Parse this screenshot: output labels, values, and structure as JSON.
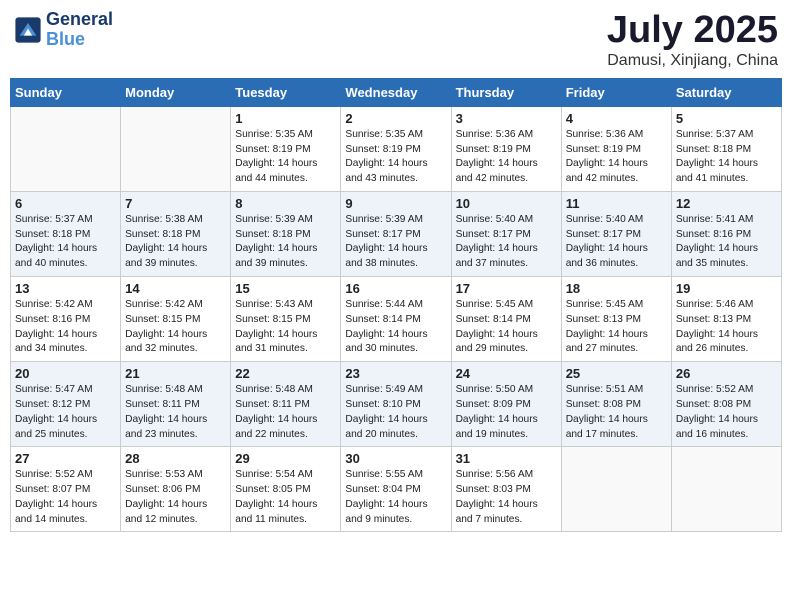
{
  "header": {
    "logo_line1": "General",
    "logo_line2": "Blue",
    "month": "July 2025",
    "location": "Damusi, Xinjiang, China"
  },
  "weekdays": [
    "Sunday",
    "Monday",
    "Tuesday",
    "Wednesday",
    "Thursday",
    "Friday",
    "Saturday"
  ],
  "weeks": [
    [
      {
        "day": "",
        "info": ""
      },
      {
        "day": "",
        "info": ""
      },
      {
        "day": "1",
        "info": "Sunrise: 5:35 AM\nSunset: 8:19 PM\nDaylight: 14 hours and 44 minutes."
      },
      {
        "day": "2",
        "info": "Sunrise: 5:35 AM\nSunset: 8:19 PM\nDaylight: 14 hours and 43 minutes."
      },
      {
        "day": "3",
        "info": "Sunrise: 5:36 AM\nSunset: 8:19 PM\nDaylight: 14 hours and 42 minutes."
      },
      {
        "day": "4",
        "info": "Sunrise: 5:36 AM\nSunset: 8:19 PM\nDaylight: 14 hours and 42 minutes."
      },
      {
        "day": "5",
        "info": "Sunrise: 5:37 AM\nSunset: 8:18 PM\nDaylight: 14 hours and 41 minutes."
      }
    ],
    [
      {
        "day": "6",
        "info": "Sunrise: 5:37 AM\nSunset: 8:18 PM\nDaylight: 14 hours and 40 minutes."
      },
      {
        "day": "7",
        "info": "Sunrise: 5:38 AM\nSunset: 8:18 PM\nDaylight: 14 hours and 39 minutes."
      },
      {
        "day": "8",
        "info": "Sunrise: 5:39 AM\nSunset: 8:18 PM\nDaylight: 14 hours and 39 minutes."
      },
      {
        "day": "9",
        "info": "Sunrise: 5:39 AM\nSunset: 8:17 PM\nDaylight: 14 hours and 38 minutes."
      },
      {
        "day": "10",
        "info": "Sunrise: 5:40 AM\nSunset: 8:17 PM\nDaylight: 14 hours and 37 minutes."
      },
      {
        "day": "11",
        "info": "Sunrise: 5:40 AM\nSunset: 8:17 PM\nDaylight: 14 hours and 36 minutes."
      },
      {
        "day": "12",
        "info": "Sunrise: 5:41 AM\nSunset: 8:16 PM\nDaylight: 14 hours and 35 minutes."
      }
    ],
    [
      {
        "day": "13",
        "info": "Sunrise: 5:42 AM\nSunset: 8:16 PM\nDaylight: 14 hours and 34 minutes."
      },
      {
        "day": "14",
        "info": "Sunrise: 5:42 AM\nSunset: 8:15 PM\nDaylight: 14 hours and 32 minutes."
      },
      {
        "day": "15",
        "info": "Sunrise: 5:43 AM\nSunset: 8:15 PM\nDaylight: 14 hours and 31 minutes."
      },
      {
        "day": "16",
        "info": "Sunrise: 5:44 AM\nSunset: 8:14 PM\nDaylight: 14 hours and 30 minutes."
      },
      {
        "day": "17",
        "info": "Sunrise: 5:45 AM\nSunset: 8:14 PM\nDaylight: 14 hours and 29 minutes."
      },
      {
        "day": "18",
        "info": "Sunrise: 5:45 AM\nSunset: 8:13 PM\nDaylight: 14 hours and 27 minutes."
      },
      {
        "day": "19",
        "info": "Sunrise: 5:46 AM\nSunset: 8:13 PM\nDaylight: 14 hours and 26 minutes."
      }
    ],
    [
      {
        "day": "20",
        "info": "Sunrise: 5:47 AM\nSunset: 8:12 PM\nDaylight: 14 hours and 25 minutes."
      },
      {
        "day": "21",
        "info": "Sunrise: 5:48 AM\nSunset: 8:11 PM\nDaylight: 14 hours and 23 minutes."
      },
      {
        "day": "22",
        "info": "Sunrise: 5:48 AM\nSunset: 8:11 PM\nDaylight: 14 hours and 22 minutes."
      },
      {
        "day": "23",
        "info": "Sunrise: 5:49 AM\nSunset: 8:10 PM\nDaylight: 14 hours and 20 minutes."
      },
      {
        "day": "24",
        "info": "Sunrise: 5:50 AM\nSunset: 8:09 PM\nDaylight: 14 hours and 19 minutes."
      },
      {
        "day": "25",
        "info": "Sunrise: 5:51 AM\nSunset: 8:08 PM\nDaylight: 14 hours and 17 minutes."
      },
      {
        "day": "26",
        "info": "Sunrise: 5:52 AM\nSunset: 8:08 PM\nDaylight: 14 hours and 16 minutes."
      }
    ],
    [
      {
        "day": "27",
        "info": "Sunrise: 5:52 AM\nSunset: 8:07 PM\nDaylight: 14 hours and 14 minutes."
      },
      {
        "day": "28",
        "info": "Sunrise: 5:53 AM\nSunset: 8:06 PM\nDaylight: 14 hours and 12 minutes."
      },
      {
        "day": "29",
        "info": "Sunrise: 5:54 AM\nSunset: 8:05 PM\nDaylight: 14 hours and 11 minutes."
      },
      {
        "day": "30",
        "info": "Sunrise: 5:55 AM\nSunset: 8:04 PM\nDaylight: 14 hours and 9 minutes."
      },
      {
        "day": "31",
        "info": "Sunrise: 5:56 AM\nSunset: 8:03 PM\nDaylight: 14 hours and 7 minutes."
      },
      {
        "day": "",
        "info": ""
      },
      {
        "day": "",
        "info": ""
      }
    ]
  ]
}
